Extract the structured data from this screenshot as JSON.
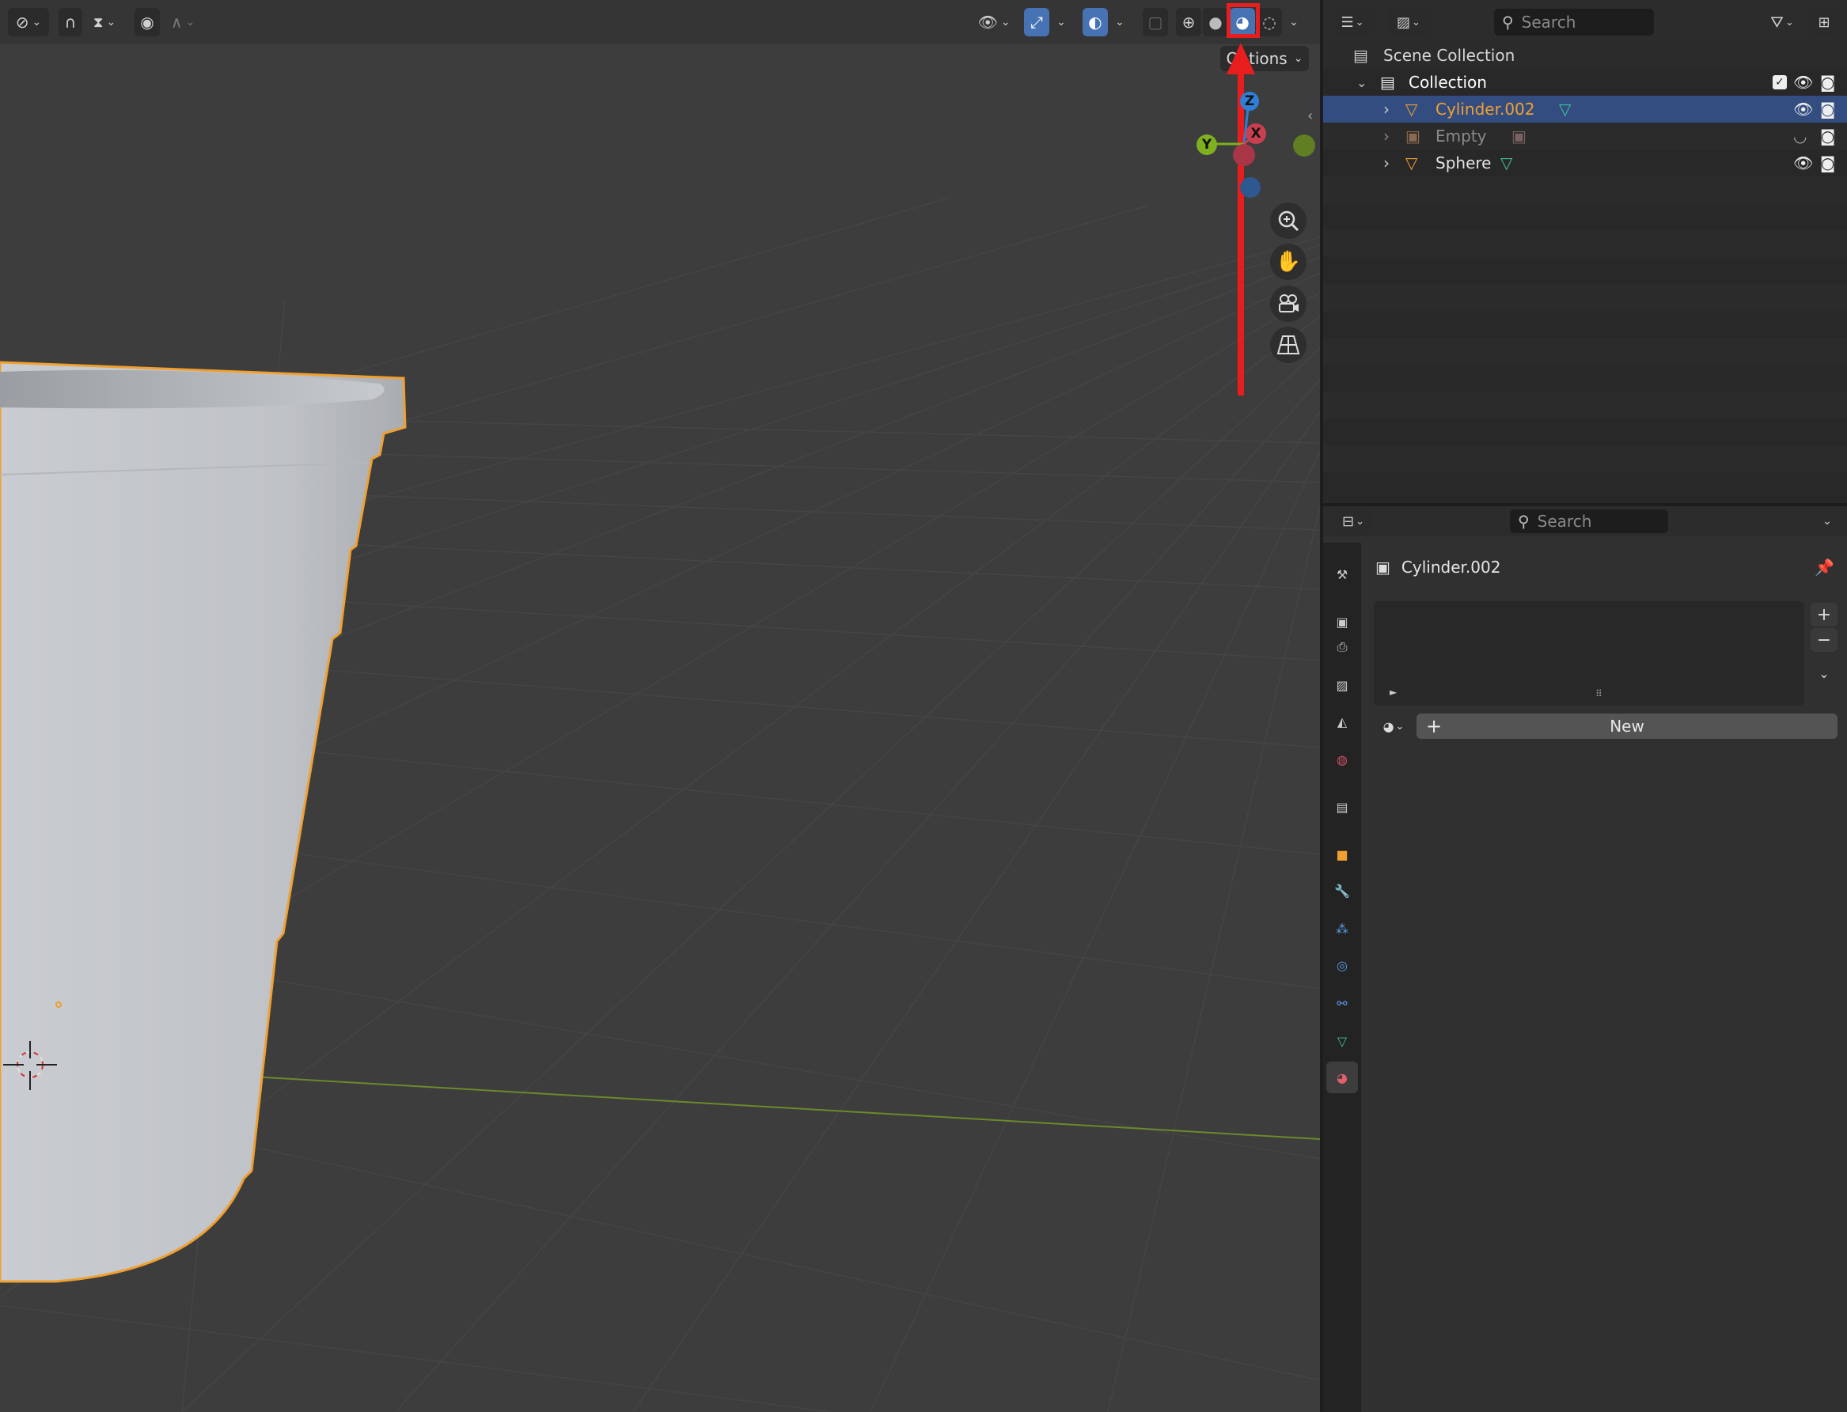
{
  "viewport": {
    "header": {
      "options_label": "Options",
      "icons": [
        "transform-pivot-icon",
        "snap-icon",
        "snap-increment-icon",
        "proportional-edit-icon",
        "falloff-curve-icon",
        "selectability-eye-icon",
        "gizmo-icon",
        "overlay-icon",
        "xray-icon",
        "wireframe-shading-icon",
        "solid-shading-icon",
        "material-preview-shading-icon",
        "rendered-shading-icon"
      ]
    },
    "gizmo": {
      "z": "Z",
      "y": "Y",
      "x": "X"
    },
    "highlight": {
      "color": "#e81e1e",
      "target": "material-preview-shading-button"
    }
  },
  "outliner": {
    "search_placeholder": "Search",
    "items": [
      {
        "label": "Scene Collection"
      },
      {
        "label": "Collection"
      },
      {
        "label": "Cylinder.002",
        "selected": true,
        "color": "#f0a030"
      },
      {
        "label": "Empty",
        "dimmed": true
      },
      {
        "label": "Sphere"
      }
    ]
  },
  "properties": {
    "search_placeholder": "Search",
    "object_name": "Cylinder.002",
    "new_button_label": "New",
    "add_slot": "+",
    "remove_slot": "−",
    "tabs": [
      "tool",
      "render",
      "output",
      "view-layer",
      "scene",
      "world",
      "collection",
      "object",
      "modifier",
      "particles",
      "physics",
      "constraints",
      "data",
      "material"
    ],
    "active_tab": "material"
  },
  "colors": {
    "accent_blue": "#4772b3",
    "selection_orange": "#f0a030",
    "x_axis": "#c8404f",
    "y_axis": "#7fb020",
    "z_axis": "#2f7fd6"
  }
}
